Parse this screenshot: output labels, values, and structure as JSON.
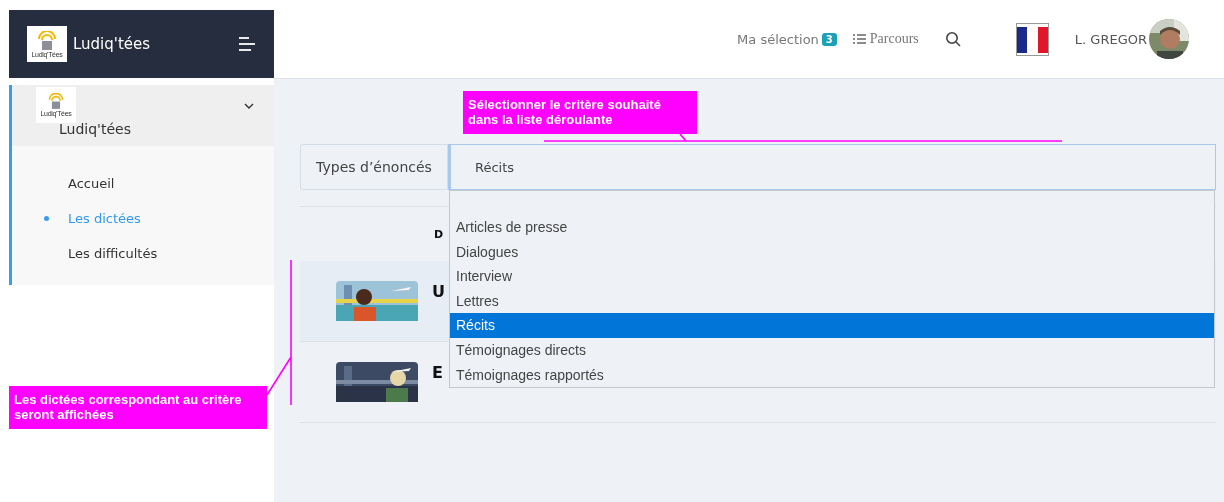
{
  "sidebar": {
    "brand": {
      "logo_text": "Ludiq'Tées",
      "title": "Ludiq'tées"
    },
    "group": {
      "logo_text": "Ludiq'Tées",
      "label": "Ludiq'tées",
      "expanded": true,
      "items": [
        {
          "label": "Accueil",
          "selected": false
        },
        {
          "label": "Les dictées",
          "selected": true
        },
        {
          "label": "Les difficultés",
          "selected": false
        }
      ]
    }
  },
  "topbar": {
    "selection": {
      "label": "Ma sélection",
      "count": "3"
    },
    "parcours": "Parcours",
    "user": "L. GREGOR"
  },
  "filter": {
    "label": "Types d’énoncés",
    "value": "Récits",
    "options": [
      {
        "label": "Articles de presse",
        "selected": false
      },
      {
        "label": "Dialogues",
        "selected": false
      },
      {
        "label": "Interview",
        "selected": false
      },
      {
        "label": "Lettres",
        "selected": false
      },
      {
        "label": "Récits",
        "selected": true
      },
      {
        "label": "Témoignages directs",
        "selected": false
      },
      {
        "label": "Témoignages rapportés",
        "selected": false
      }
    ]
  },
  "list": {
    "column_1": "D",
    "rows": [
      {
        "title": "U",
        "kind": "picture"
      },
      {
        "title": "E",
        "kind": "picture"
      }
    ]
  },
  "callouts": [
    "Sélectionner le critère souhaité dans la liste déroulante",
    "Les dictées correspondant au critère seront affichées"
  ]
}
